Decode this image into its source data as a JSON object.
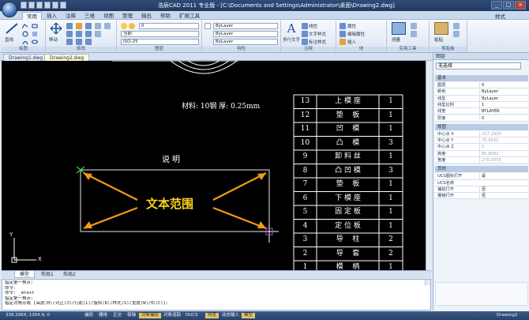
{
  "window": {
    "title": "浩辰CAD 2011 专业版 - [C:\\Documents and Settings\\Administrator\\桌面\\Drawing2.dwg]",
    "style_label": "样式",
    "buttons": [
      "_",
      "□",
      "×"
    ]
  },
  "ribbon": {
    "tabs": [
      "常用",
      "插入",
      "注释",
      "三维",
      "视图",
      "管理",
      "输出",
      "帮助",
      "扩展工具"
    ],
    "groups": [
      {
        "label": "绘图",
        "items": [
          "直线",
          "多段线",
          "圆",
          "圆弧"
        ]
      },
      {
        "label": "修改",
        "items": [
          "移动"
        ]
      },
      {
        "label": "图层",
        "layer_value": "0",
        "combo1": "当前",
        "combo2": "ISO-25"
      },
      {
        "label": "特性",
        "color": "ByLayer",
        "linetype": "ByLayer",
        "lineweight": "ByLayer"
      },
      {
        "label": "注释",
        "items": [
          "多行文字",
          "线性",
          "文字样式",
          "标注样式"
        ]
      },
      {
        "label": "块",
        "items": [
          "属性",
          "编辑属性",
          "插入"
        ]
      },
      {
        "label": "实用工具",
        "items": [
          "测量"
        ]
      },
      {
        "label": "剪贴板",
        "items": [
          "粘贴"
        ]
      }
    ]
  },
  "doc_tabs": [
    "Drawing1.dwg",
    "Drawing2.dwg"
  ],
  "drawing": {
    "material_note": "材料: 10钢 厚: 0.25mm",
    "shuoming": "说明",
    "text_range_label": "文本范围",
    "ucs_x": "X",
    "ucs_y": "Y",
    "parts_table": [
      [
        "13",
        "上 模 座",
        "1"
      ],
      [
        "12",
        "垫    板",
        "1"
      ],
      [
        "11",
        "凹    模",
        "1"
      ],
      [
        "10",
        "凸    模",
        "3"
      ],
      [
        "9",
        "卸 料 丝",
        "1"
      ],
      [
        "8",
        "凸 凹 模",
        "3"
      ],
      [
        "7",
        "垫    板",
        "1"
      ],
      [
        "6",
        "下 模 座",
        "1"
      ],
      [
        "5",
        "固 定 板",
        "1"
      ],
      [
        "4",
        "定 位 板",
        "1"
      ],
      [
        "3",
        "导    柱",
        "2"
      ],
      [
        "2",
        "导    套",
        "2"
      ],
      [
        "1",
        "模    柄",
        "1"
      ]
    ]
  },
  "layout_tabs": [
    "模型",
    "布局1",
    "布局2"
  ],
  "command_lines": [
    "指定第一角点:",
    "命令:",
    "命令: _mtext",
    "指定第一角点:",
    "指定对角点或 [高度(H)/对正(J)/行距(L)/旋转(R)/样式(S)/宽度(W)/栏(C)]:"
  ],
  "status": {
    "coords": "338.2964, 1304.9, 0",
    "toggles": [
      {
        "label": "捕捉",
        "on": false
      },
      {
        "label": "栅格",
        "on": false
      },
      {
        "label": "正交",
        "on": false
      },
      {
        "label": "极轴",
        "on": false
      },
      {
        "label": "对象捕捉",
        "on": true
      },
      {
        "label": "对象追踪",
        "on": false
      },
      {
        "label": "DUCS",
        "on": false
      },
      {
        "label": "线宽",
        "on": true
      },
      {
        "label": "动态输入",
        "on": false
      },
      {
        "label": "模型",
        "on": true
      }
    ],
    "right_label": "Drawing2"
  },
  "properties": {
    "title": "图层",
    "selection": "无选择",
    "sections": [
      {
        "label": "基本",
        "rows": [
          [
            "图层",
            "0"
          ],
          [
            "颜色",
            "ByLayer"
          ],
          [
            "线型",
            "ByLayer"
          ],
          [
            "线型比例",
            "1"
          ],
          [
            "线宽",
            "BYLAYER"
          ],
          [
            "厚度",
            "0"
          ]
        ]
      },
      {
        "label": "视图",
        "rows": [
          [
            "中心点 X",
            "217.2930"
          ],
          [
            "中心点 Y",
            "75.6531"
          ],
          [
            "中心点 Z",
            "0"
          ],
          [
            "高度",
            "85.8582"
          ],
          [
            "宽度",
            "276.0035"
          ]
        ]
      },
      {
        "label": "其他",
        "rows": [
          [
            "UCS图标打开",
            "是"
          ],
          [
            "UCS名称",
            ""
          ],
          [
            "捕捉打开",
            "否"
          ],
          [
            "栅格打开",
            "否"
          ]
        ]
      }
    ]
  },
  "colors": {
    "canvas": "#000000",
    "arrow": "#f39c12",
    "text_range": "#ffd21a",
    "grip": "#3ad43a"
  }
}
